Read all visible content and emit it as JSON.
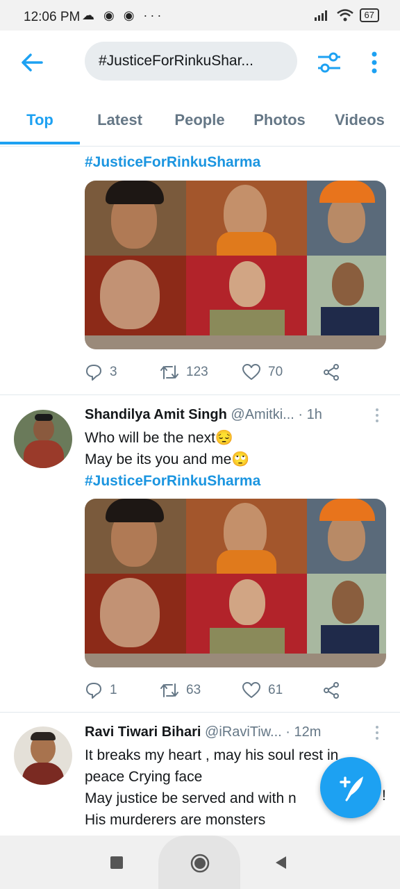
{
  "status_bar": {
    "time": "12:06 PM",
    "icons": "☁ ◉ ◉ ···",
    "battery": "67"
  },
  "app_bar": {
    "search_value": "#JusticeForRinkuShar..."
  },
  "tabs": [
    {
      "label": "Top",
      "active": true
    },
    {
      "label": "Latest",
      "active": false
    },
    {
      "label": "People",
      "active": false
    },
    {
      "label": "Photos",
      "active": false
    },
    {
      "label": "Videos",
      "active": false
    }
  ],
  "tweets": [
    {
      "hashtag": "#JusticeForRinkuSharma",
      "actions": {
        "replies": "3",
        "retweets": "123",
        "likes": "70"
      }
    },
    {
      "name": "Shandilya Amit Singh",
      "handle": "@Amitki...",
      "time": "· 1h",
      "lines": [
        "Who will be the next😔",
        "May be its you and me🙄"
      ],
      "hashtag": "#JusticeForRinkuSharma",
      "actions": {
        "replies": "1",
        "retweets": "63",
        "likes": "61"
      }
    },
    {
      "name": "Ravi Tiwari Bihari",
      "handle": "@iRaviTiw...",
      "time": "· 12m",
      "lines": [
        "It breaks my heart , may his soul rest in",
        "peace Crying face",
        "May justice be served and with n",
        "His murderers are monsters"
      ],
      "trailing": "!"
    }
  ],
  "colors": {
    "accent": "#1da1f2",
    "hashtag": "#1b95e0",
    "muted": "#657786"
  },
  "icons": [
    "back-arrow-icon",
    "filter-icon",
    "more-vertical-icon",
    "reply-icon",
    "retweet-icon",
    "like-icon",
    "share-icon",
    "compose-icon",
    "recents-icon",
    "home-icon",
    "back-nav-icon"
  ]
}
